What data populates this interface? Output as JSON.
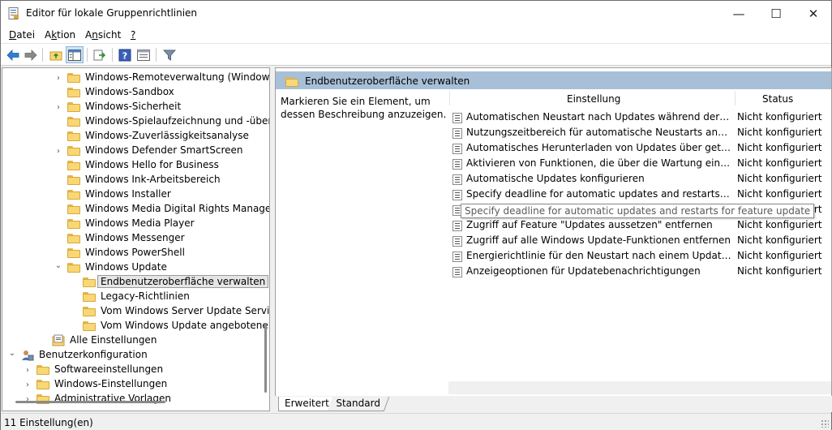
{
  "window": {
    "title": "Editor für lokale Gruppenrichtlinien",
    "buttons": {
      "minimize": "—",
      "maximize": "☐",
      "close": "✕"
    }
  },
  "menu": {
    "items": [
      {
        "label": "Datei",
        "accel": "D",
        "rest": "atei"
      },
      {
        "label": "Aktion",
        "accel": "k",
        "rest_pre": "A",
        "rest": "tion"
      },
      {
        "label": "Ansicht",
        "accel": "n",
        "rest_pre": "A",
        "rest": "sicht"
      },
      {
        "label": "?"
      }
    ]
  },
  "toolbar": {
    "icons": [
      "back-icon",
      "forward-icon",
      "up-folder-icon",
      "show-hide-tree-icon",
      "export-list-icon",
      "help-icon",
      "properties-icon",
      "filter-icon"
    ]
  },
  "tree": {
    "items": [
      {
        "label": "Windows-Remoteverwaltung (Windows",
        "expandable": true
      },
      {
        "label": "Windows-Sandbox",
        "expandable": false
      },
      {
        "label": "Windows-Sicherheit",
        "expandable": true
      },
      {
        "label": "Windows-Spielaufzeichnung und -übertr",
        "expandable": false
      },
      {
        "label": "Windows-Zuverlässigkeitsanalyse",
        "expandable": false
      },
      {
        "label": "Windows Defender SmartScreen",
        "expandable": true
      },
      {
        "label": "Windows Hello for Business",
        "expandable": false
      },
      {
        "label": "Windows Ink-Arbeitsbereich",
        "expandable": false
      },
      {
        "label": "Windows Installer",
        "expandable": false
      },
      {
        "label": "Windows Media Digital Rights Managem",
        "expandable": false
      },
      {
        "label": "Windows Media Player",
        "expandable": false
      },
      {
        "label": "Windows Messenger",
        "expandable": false
      },
      {
        "label": "Windows PowerShell",
        "expandable": false
      },
      {
        "label": "Windows Update",
        "expandable": true,
        "expanded": true
      },
      {
        "label": "Endbenutzeroberfläche verwalten",
        "selected": true
      },
      {
        "label": "Legacy-Richtlinien"
      },
      {
        "label": "Vom Windows Server Update Service"
      },
      {
        "label": "Vom Windows Update angebotene U"
      },
      {
        "label": "Alle Einstellungen"
      },
      {
        "label": "Benutzerkonfiguration",
        "expanded": true
      },
      {
        "label": "Softwareeinstellungen",
        "expandable": true
      },
      {
        "label": "Windows-Einstellungen",
        "expandable": true
      },
      {
        "label": "Administrative Vorlagen",
        "expandable": true
      }
    ]
  },
  "details": {
    "header_title": "Endbenutzeroberfläche verwalten",
    "description": "Markieren Sie ein Element, um dessen Beschreibung anzuzeigen.",
    "columns": {
      "setting": "Einstellung",
      "status": "Status"
    },
    "rows": [
      {
        "name": "Automatischen Neustart nach Updates während der Nutzun...",
        "status": "Nicht konfiguriert"
      },
      {
        "name": "Nutzungszeitbereich für automatische Neustarts angeben",
        "status": "Nicht konfiguriert"
      },
      {
        "name": "Automatisches Herunterladen von Updates über getaktete V...",
        "status": "Nicht konfiguriert"
      },
      {
        "name": "Aktivieren von Funktionen, die über die Wartung eingeführt ...",
        "status": "Nicht konfiguriert"
      },
      {
        "name": "Automatische Updates konfigurieren",
        "status": "Nicht konfiguriert"
      },
      {
        "name": "Specify deadline for automatic updates and restarts for quali...",
        "status": "Nicht konfiguriert"
      },
      {
        "name": "Specify deadline for automatic updates and restarts for feature update",
        "status": "Nicht konfiguriert"
      },
      {
        "name": "Zugriff auf Feature \"Updates aussetzen\" entfernen",
        "status": "Nicht konfiguriert"
      },
      {
        "name": "Zugriff auf alle Windows Update-Funktionen entfernen",
        "status": "Nicht konfiguriert"
      },
      {
        "name": "Energierichtlinie für den Neustart nach einem Update, die fü...",
        "status": "Nicht konfiguriert"
      },
      {
        "name": "Anzeigeoptionen für Updatebenachrichtigungen",
        "status": "Nicht konfiguriert"
      }
    ],
    "tooltip": "Specify deadline for automatic updates and restarts for feature update"
  },
  "tabs": {
    "extended": "Erweitert",
    "standard": "Standard"
  },
  "status_bar": {
    "text": "11 Einstellung(en)"
  }
}
